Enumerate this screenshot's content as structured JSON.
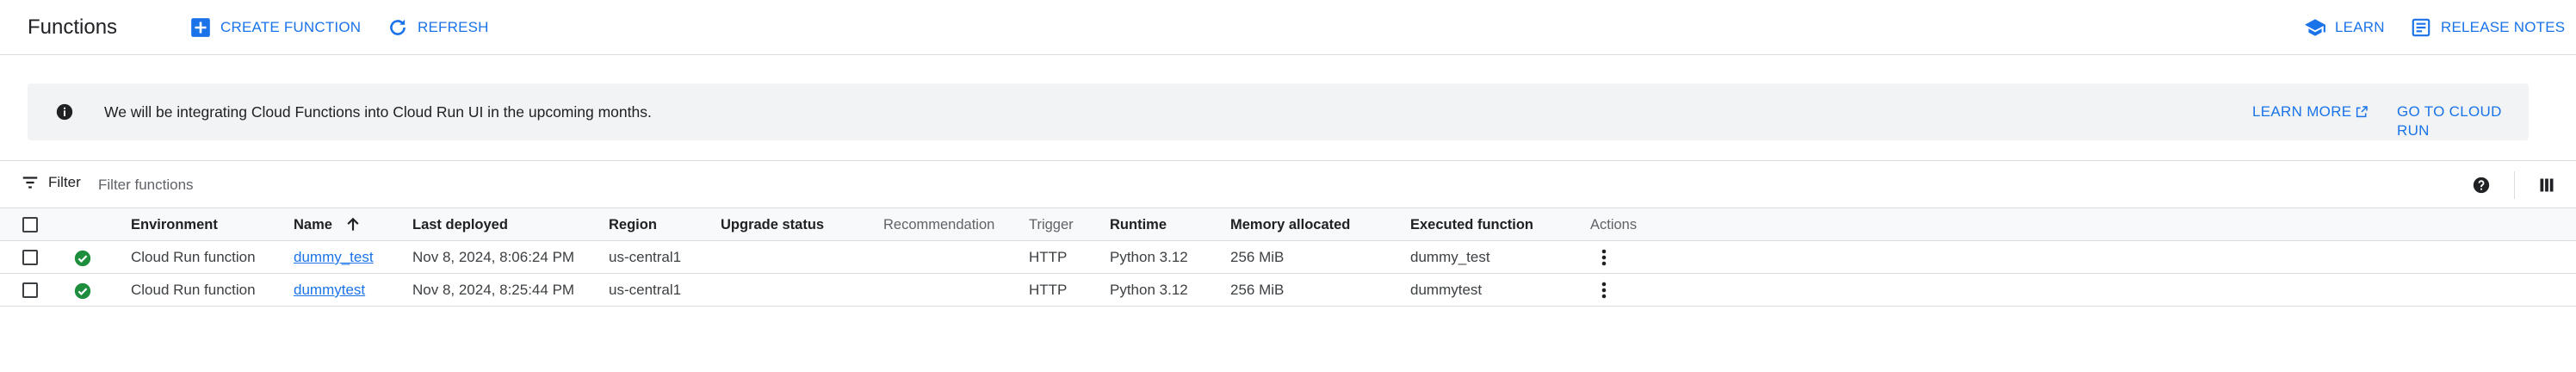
{
  "header": {
    "title": "Functions",
    "create_label": "CREATE FUNCTION",
    "refresh_label": "REFRESH",
    "learn_label": "LEARN",
    "release_notes_label": "RELEASE NOTES"
  },
  "banner": {
    "message": "We will be integrating Cloud Functions into Cloud Run UI in the upcoming months.",
    "learn_more_label": "LEARN MORE",
    "go_to_cloud_run_label": "GO TO CLOUD RUN"
  },
  "filter": {
    "label": "Filter",
    "placeholder": "Filter functions"
  },
  "table": {
    "columns": {
      "environment": "Environment",
      "name": "Name",
      "last_deployed": "Last deployed",
      "region": "Region",
      "upgrade_status": "Upgrade status",
      "recommendation": "Recommendation",
      "trigger": "Trigger",
      "runtime": "Runtime",
      "memory": "Memory allocated",
      "executed_function": "Executed function",
      "actions": "Actions"
    },
    "rows": [
      {
        "environment": "Cloud Run function",
        "name": "dummy_test",
        "last_deployed": "Nov 8, 2024, 8:06:24 PM",
        "region": "us-central1",
        "trigger": "HTTP",
        "runtime": "Python 3.12",
        "memory": "256 MiB",
        "executed_function": "dummy_test",
        "status": "ok"
      },
      {
        "environment": "Cloud Run function",
        "name": "dummytest",
        "last_deployed": "Nov 8, 2024, 8:25:44 PM",
        "region": "us-central1",
        "trigger": "HTTP",
        "runtime": "Python 3.12",
        "memory": "256 MiB",
        "executed_function": "dummytest",
        "status": "ok"
      }
    ]
  },
  "colors": {
    "accent": "#1a73e8",
    "success": "#1e8e3e",
    "banner_bg": "#f1f3f4"
  },
  "icons": {
    "create": "add-box-icon",
    "refresh": "refresh-icon",
    "learn": "school-icon",
    "release_notes": "notes-icon",
    "info": "info-icon",
    "external": "open-in-new-icon",
    "filter": "filter-list-icon",
    "help": "help-icon",
    "columns": "column-picker-icon",
    "sort": "arrow-up-icon",
    "status": "check-circle-icon",
    "actions": "more-vert-icon"
  }
}
